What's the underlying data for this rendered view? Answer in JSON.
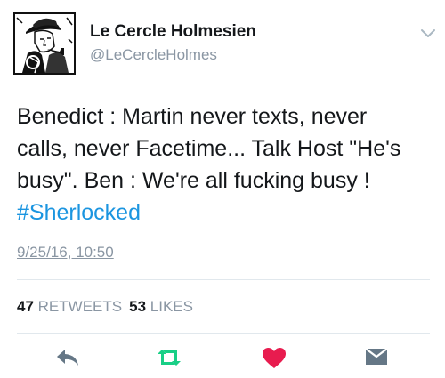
{
  "profile": {
    "name": "Le Cercle Holmesien",
    "handle": "@LeCercleHolmes",
    "avatar_icon": "sherlock-portrait-avatar",
    "menu_icon": "chevron-down-icon"
  },
  "tweet": {
    "text": "Benedict : Martin never texts, never\ncalls, never Facetime... Talk Host \"He's\nbusy\". Ben : We're all fucking busy !",
    "hashtag": "#Sherlocked",
    "timestamp": "9/25/16, 10:50"
  },
  "stats": {
    "retweets_count": "47",
    "retweets_label": "RETWEETS",
    "likes_count": "53",
    "likes_label": "LIKES"
  },
  "actions": {
    "reply_icon": "reply-icon",
    "retweet_icon": "retweet-icon",
    "like_icon": "heart-icon",
    "dm_icon": "envelope-icon"
  },
  "colors": {
    "link": "#1b95e0",
    "secondary_text": "#8a96a3",
    "retweet": "#19cf86",
    "like": "#e81c4f",
    "divider": "#e1e8ed"
  }
}
